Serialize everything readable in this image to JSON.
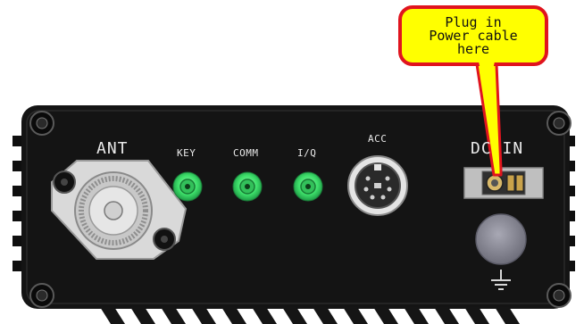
{
  "callout": {
    "lines": [
      "Plug in",
      "Power cable",
      "here"
    ],
    "fill": "#ffff00",
    "stroke": "#e0141e"
  },
  "panel": {
    "labels": {
      "ant": "ANT",
      "key": "KEY",
      "comm": "COMM",
      "iq": "I/Q",
      "acc": "ACC",
      "dc_in": "DC IN"
    },
    "body_color": "#141414",
    "label_color": "#e9e9e9",
    "jack_color": "#3ee06b"
  }
}
